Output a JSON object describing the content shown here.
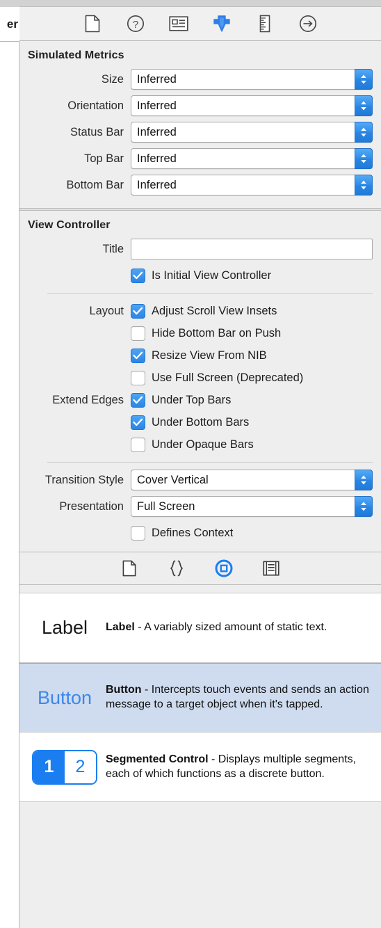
{
  "left_panel": {
    "cut_label": "er"
  },
  "inspector_tabs": [
    {
      "name": "file-inspector-icon",
      "label": "File Inspector",
      "selected": false
    },
    {
      "name": "quick-help-inspector-icon",
      "label": "Quick Help Inspector",
      "selected": false
    },
    {
      "name": "identity-inspector-icon",
      "label": "Identity Inspector",
      "selected": false
    },
    {
      "name": "attributes-inspector-icon",
      "label": "Attributes Inspector",
      "selected": true
    },
    {
      "name": "size-inspector-icon",
      "label": "Size Inspector",
      "selected": false
    },
    {
      "name": "connections-inspector-icon",
      "label": "Connections Inspector",
      "selected": false
    }
  ],
  "simulated_metrics": {
    "title": "Simulated Metrics",
    "fields": [
      {
        "label": "Size",
        "value": "Inferred"
      },
      {
        "label": "Orientation",
        "value": "Inferred"
      },
      {
        "label": "Status Bar",
        "value": "Inferred"
      },
      {
        "label": "Top Bar",
        "value": "Inferred"
      },
      {
        "label": "Bottom Bar",
        "value": "Inferred"
      }
    ]
  },
  "view_controller": {
    "title": "View Controller",
    "title_field": {
      "label": "Title",
      "value": "",
      "placeholder": ""
    },
    "is_initial": {
      "label": "Is Initial View Controller",
      "checked": true
    },
    "layout": {
      "label": "Layout",
      "items": [
        {
          "label": "Adjust Scroll View Insets",
          "checked": true
        },
        {
          "label": "Hide Bottom Bar on Push",
          "checked": false
        },
        {
          "label": "Resize View From NIB",
          "checked": true
        },
        {
          "label": "Use Full Screen (Deprecated)",
          "checked": false
        }
      ]
    },
    "extend_edges": {
      "label": "Extend Edges",
      "items": [
        {
          "label": "Under Top Bars",
          "checked": true
        },
        {
          "label": "Under Bottom Bars",
          "checked": true
        },
        {
          "label": "Under Opaque Bars",
          "checked": false
        }
      ]
    },
    "transition_style": {
      "label": "Transition Style",
      "value": "Cover Vertical"
    },
    "presentation": {
      "label": "Presentation",
      "value": "Full Screen"
    },
    "defines_context": {
      "label": "Defines Context",
      "checked": false
    }
  },
  "library_tabs": [
    {
      "name": "file-template-library-icon",
      "label": "File Template Library",
      "selected": false
    },
    {
      "name": "code-snippet-library-icon",
      "label": "Code Snippet Library",
      "selected": false
    },
    {
      "name": "object-library-icon",
      "label": "Object Library",
      "selected": true
    },
    {
      "name": "media-library-icon",
      "label": "Media Library",
      "selected": false
    }
  ],
  "library_items": [
    {
      "thumb_type": "label",
      "thumb_text": "Label",
      "name": "Label",
      "description": " - A variably sized amount of static text.",
      "selected": false
    },
    {
      "thumb_type": "button",
      "thumb_text": "Button",
      "name": "Button",
      "description": " - Intercepts touch events and sends an action message to a target object when it's tapped.",
      "selected": true
    },
    {
      "thumb_type": "segmented",
      "thumb_segment_1": "1",
      "thumb_segment_2": "2",
      "name": "Segmented Control",
      "description": " - Displays multiple segments, each of which functions as a discrete button.",
      "selected": false
    }
  ],
  "colors": {
    "accent_blue": "#2a86e6",
    "selection_blue": "#cfdcef",
    "panel_bg": "#eeeeee",
    "list_bg": "#ffffff"
  }
}
